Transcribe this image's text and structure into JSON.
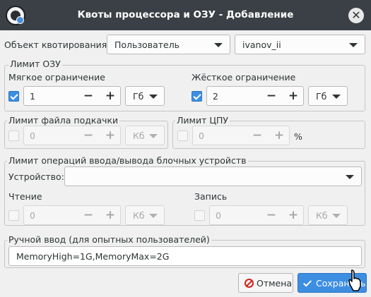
{
  "window": {
    "title": "Квоты процессора и ОЗУ - Добавление",
    "close_glyph": "✕"
  },
  "object": {
    "label": "Объект квотирования:",
    "type_value": "Пользователь",
    "name_value": "ivanov_ii"
  },
  "ram": {
    "title": "Лимит ОЗУ",
    "soft": {
      "label": "Мягкое ограничение",
      "checked": true,
      "value": "1",
      "unit": "Гб"
    },
    "hard": {
      "label": "Жёсткое ограничение",
      "checked": true,
      "value": "2",
      "unit": "Гб"
    }
  },
  "swap": {
    "title": "Лимит файла подкачки",
    "checked": false,
    "value": "0",
    "unit": "Кб"
  },
  "cpu": {
    "title": "Лимит ЦПУ",
    "checked": false,
    "value": "0",
    "unit": "%"
  },
  "io": {
    "title": "Лимит операций ввода/вывода блочных устройств",
    "device_label": "Устройство:",
    "device_value": "",
    "read": {
      "label": "Чтение",
      "checked": false,
      "value": "0",
      "unit": "Кб"
    },
    "write": {
      "label": "Запись",
      "checked": false,
      "value": "0",
      "unit": "Кб"
    }
  },
  "manual": {
    "title": "Ручной ввод (для опытных пользователей)",
    "value": "MemoryHigh=1G,MemoryMax=2G"
  },
  "buttons": {
    "cancel": "Отмена",
    "save": "Сохранить"
  },
  "spin_glyphs": {
    "minus": "−",
    "plus": "+"
  },
  "colors": {
    "accent": "#3d8ee1",
    "titlebar": "#3b4046",
    "cancel_icon": "#d0241a"
  }
}
